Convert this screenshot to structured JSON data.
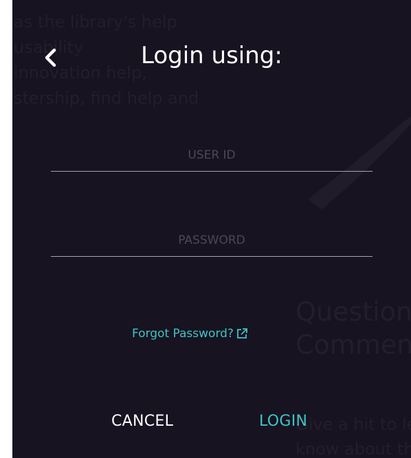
{
  "background": {
    "left_lines": [
      "as the library's help",
      "usability",
      "innovation help,",
      "stership, find help and"
    ],
    "right_heading": [
      "Question",
      "Comments"
    ],
    "right_body": [
      "Give a hit to le",
      "know about the"
    ]
  },
  "header": {
    "back_icon": "chevron-left-icon",
    "title": "Login using:"
  },
  "form": {
    "user_id_placeholder": "USER ID",
    "user_id_value": "",
    "password_placeholder": "PASSWORD",
    "password_value": ""
  },
  "links": {
    "forgot_password": "Forgot Password?",
    "forgot_icon": "external-link-icon"
  },
  "actions": {
    "cancel": "CANCEL",
    "login": "LOGIN"
  },
  "colors": {
    "overlay": "#171320",
    "accent": "#3fc4c8",
    "text": "#ffffff",
    "placeholder": "#4c4854",
    "underline": "#a9a6ae"
  }
}
